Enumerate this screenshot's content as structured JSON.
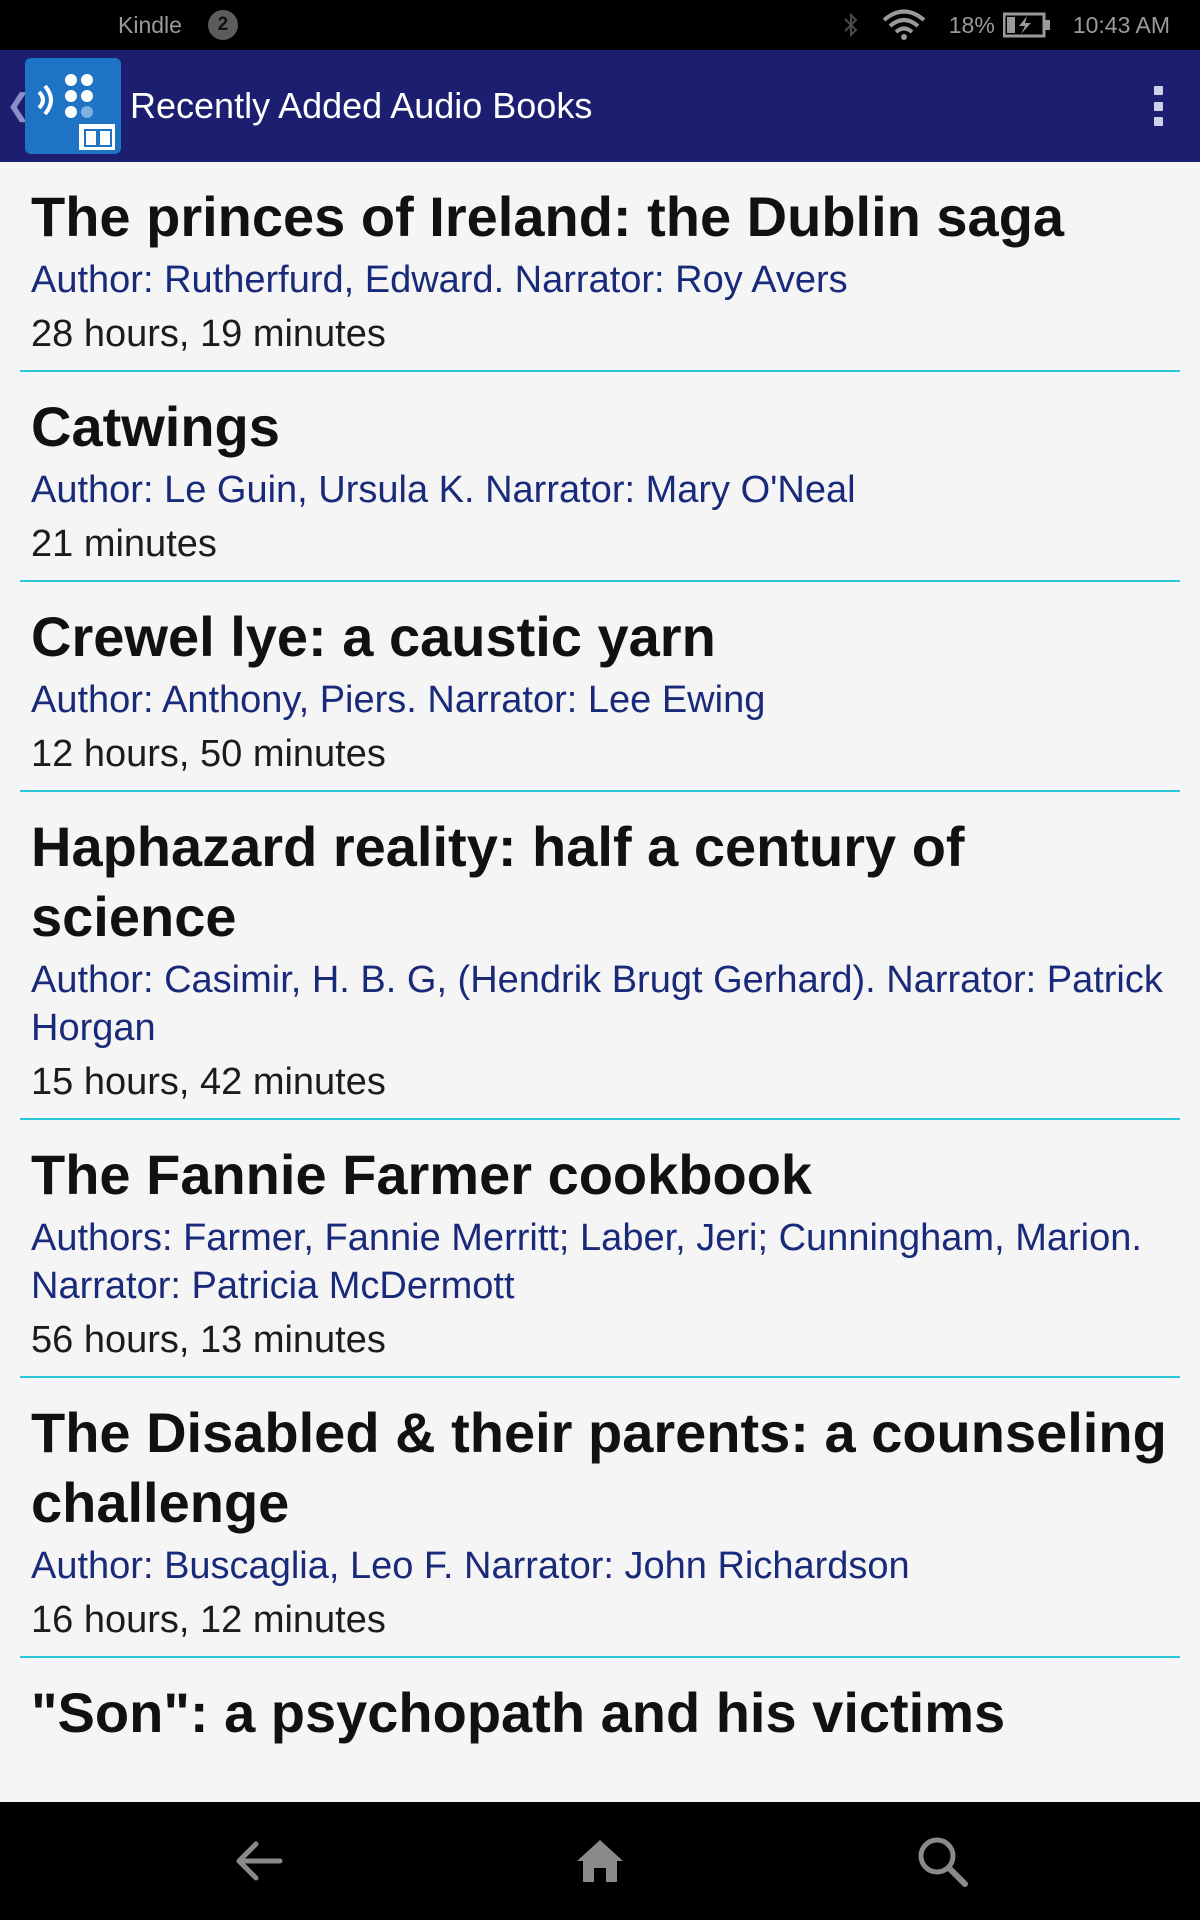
{
  "status_bar": {
    "carrier": "Kindle",
    "notification_count": "2",
    "battery_percent": "18%",
    "time": "10:43 AM",
    "icons": [
      "bluetooth-icon",
      "wifi-icon",
      "battery-charging-icon"
    ]
  },
  "app_bar": {
    "title": "Recently Added Audio Books",
    "icons": [
      "up-chevron-icon",
      "audiobook-app-logo",
      "overflow-menu-icon"
    ]
  },
  "books": [
    {
      "title": "The princes of Ireland: the Dublin saga",
      "credits": "Author: Rutherfurd, Edward. Narrator: Roy Avers",
      "duration": "28 hours, 19 minutes"
    },
    {
      "title": "Catwings",
      "credits": "Author: Le Guin, Ursula K. Narrator: Mary O'Neal",
      "duration": "21 minutes"
    },
    {
      "title": "Crewel lye: a caustic yarn",
      "credits": "Author: Anthony, Piers. Narrator: Lee Ewing",
      "duration": "12 hours, 50 minutes"
    },
    {
      "title": "Haphazard reality: half a century of science",
      "credits": "Author: Casimir, H. B. G, (Hendrik Brugt Gerhard). Narrator: Patrick Horgan",
      "duration": "15 hours, 42 minutes"
    },
    {
      "title": "The Fannie Farmer cookbook",
      "credits": "Authors: Farmer, Fannie Merritt; Laber, Jeri; Cunningham, Marion. Narrator: Patricia McDermott",
      "duration": "56 hours, 13 minutes"
    },
    {
      "title": "The Disabled & their parents: a counseling challenge",
      "credits": "Author: Buscaglia, Leo F. Narrator: John Richardson",
      "duration": "16 hours, 12 minutes"
    },
    {
      "title": "\"Son\": a psychopath and his victims",
      "credits": "",
      "duration": ""
    }
  ],
  "nav_bar": {
    "icons": [
      "back-arrow-icon",
      "home-icon",
      "search-icon"
    ]
  },
  "colors": {
    "app_bar": "#1c1f70",
    "divider": "#29c8d8",
    "credits_text": "#1a2a7a",
    "logo_bg": "#1e73c4"
  }
}
